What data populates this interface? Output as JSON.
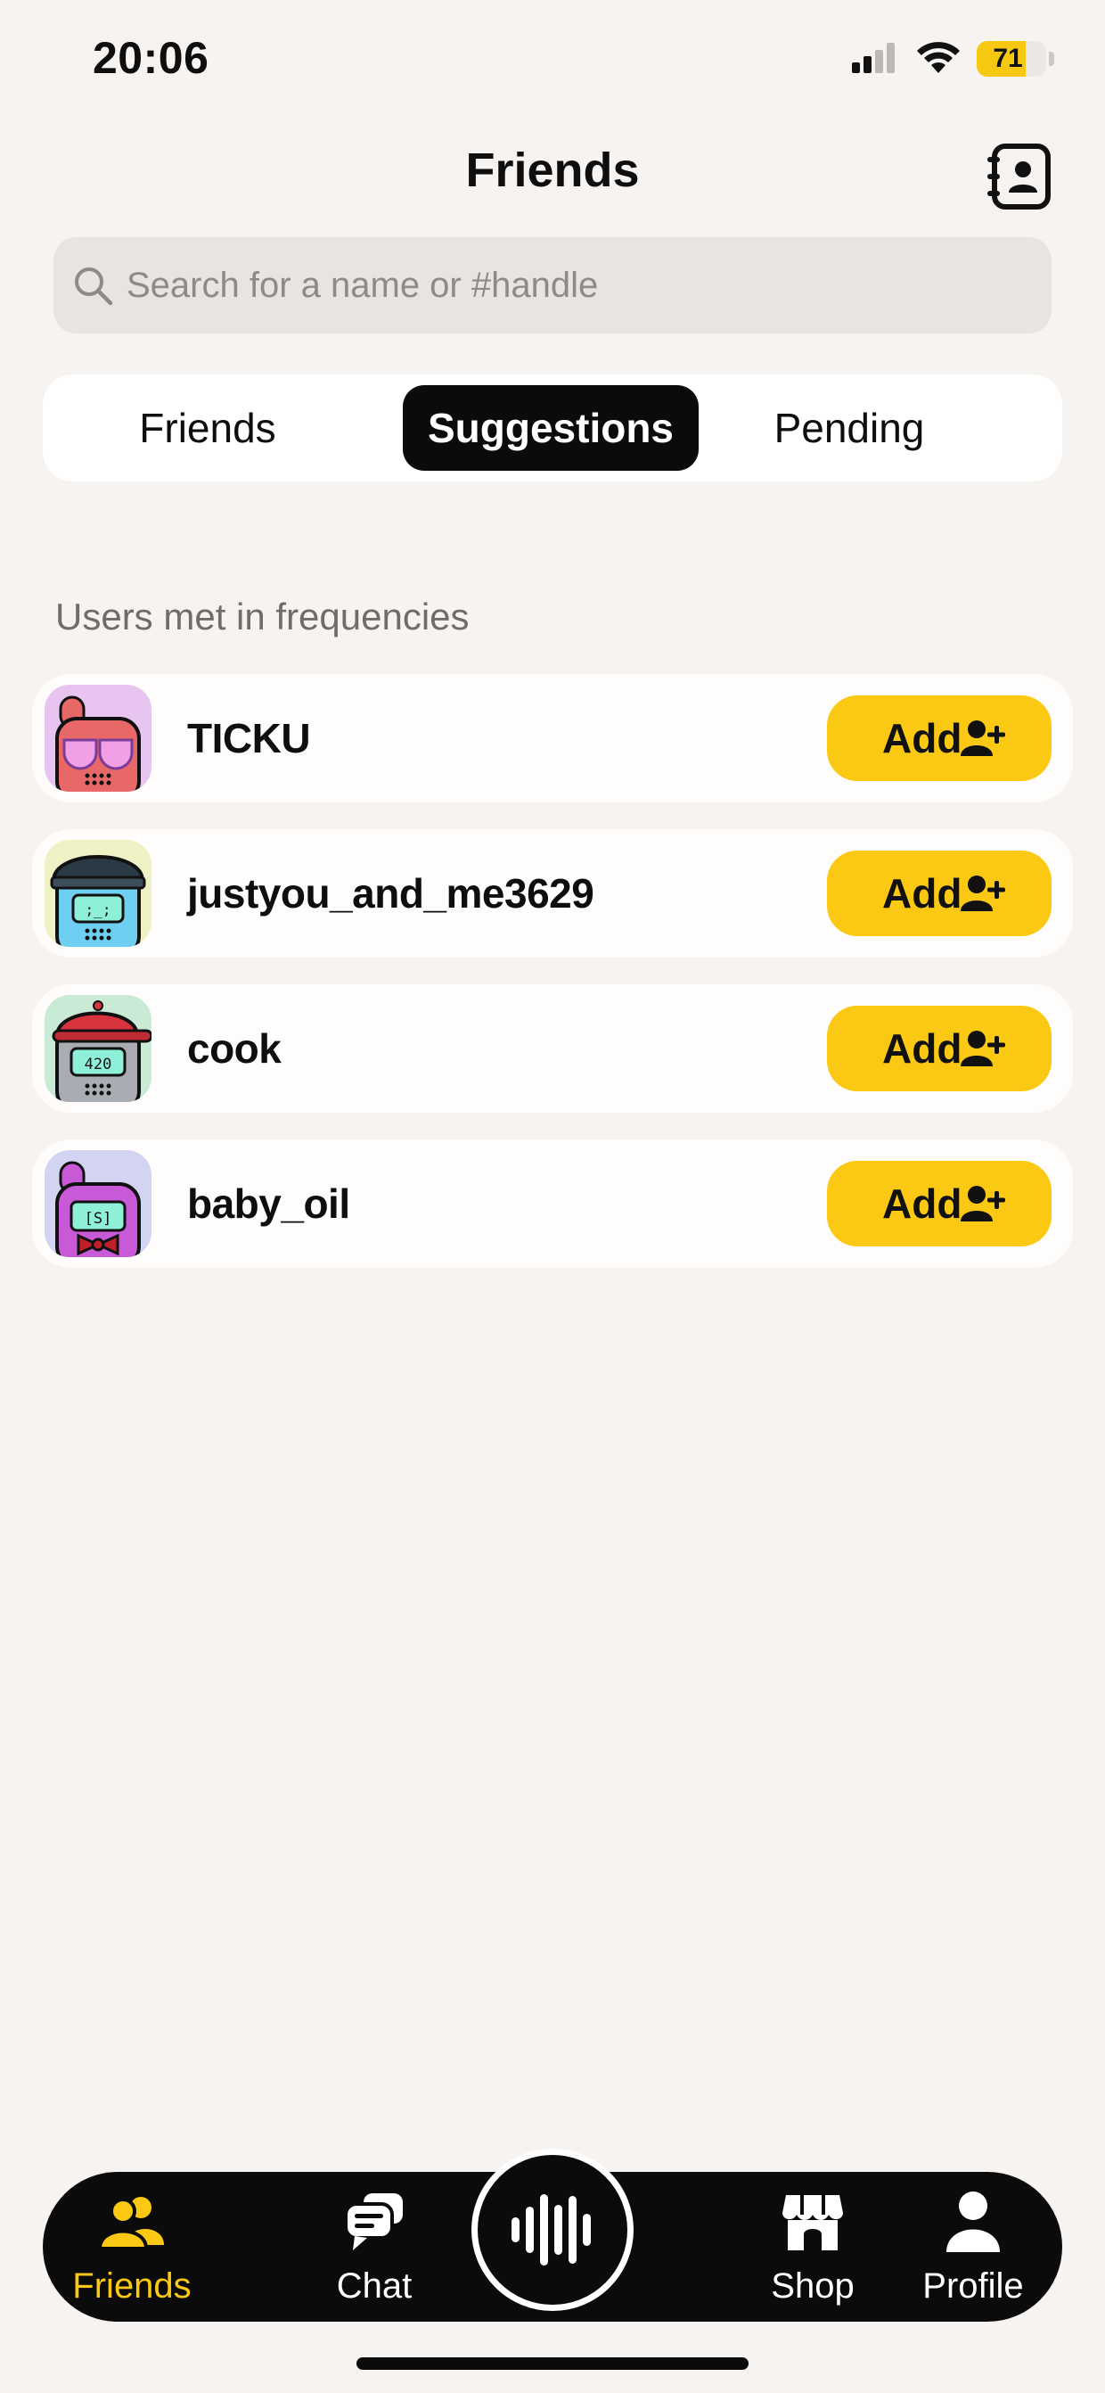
{
  "status": {
    "time": "20:06",
    "battery": "71",
    "battery_level": 0.71
  },
  "header": {
    "title": "Friends"
  },
  "search": {
    "placeholder": "Search for a name or #handle",
    "value": ""
  },
  "tabs": [
    {
      "label": "Friends",
      "active": false
    },
    {
      "label": "Suggestions",
      "active": true
    },
    {
      "label": "Pending",
      "active": false
    }
  ],
  "section": {
    "label": "Users met in frequencies"
  },
  "users": [
    {
      "name": "TICKU",
      "add_label": "Add"
    },
    {
      "name": "justyou_and_me3629",
      "add_label": "Add"
    },
    {
      "name": "cook",
      "add_label": "Add"
    },
    {
      "name": "baby_oil",
      "add_label": "Add"
    }
  ],
  "nav": [
    {
      "label": "Friends",
      "icon": "friends-icon",
      "active": true
    },
    {
      "label": "Chat",
      "icon": "chat-icon",
      "active": false
    },
    {
      "label": "",
      "icon": "voice-wave-icon",
      "active": false
    },
    {
      "label": "Shop",
      "icon": "shop-icon",
      "active": false
    },
    {
      "label": "Profile",
      "icon": "profile-icon",
      "active": false
    }
  ],
  "colors": {
    "accent": "#fbc913",
    "background": "#f7f3f0",
    "nav_background": "#0b0b0b"
  }
}
